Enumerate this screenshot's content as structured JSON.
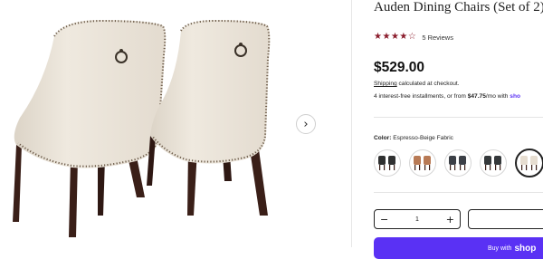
{
  "product": {
    "title": "Auden Dining Chairs (Set of 2)",
    "rating": {
      "stars": 4,
      "max": 5,
      "filled_color": "#8b1c2c",
      "empty_color": "#8b1c2c"
    },
    "reviews_text": "5 Reviews",
    "price": "$529.00",
    "shipping_link": "Shipping",
    "shipping_rest": " calculated at checkout.",
    "installments_prefix": "4 interest-free installments, or from ",
    "installments_amount": "$47.75",
    "installments_suffix": "/mo with ",
    "installments_link": "sho"
  },
  "gallery": {
    "next_icon": "chevron-right-icon",
    "next_glyph": "›"
  },
  "options": {
    "color_label": "Color:",
    "color_value": "Espresso-Beige Fabric",
    "swatches": [
      {
        "color": "#2f3030",
        "selected": false
      },
      {
        "color": "#b87a55",
        "selected": false
      },
      {
        "color": "#3b3f46",
        "selected": false
      },
      {
        "color": "#34383a",
        "selected": false
      },
      {
        "color": "#e6ddd0",
        "selected": true
      }
    ]
  },
  "cart": {
    "minus": "−",
    "quantity": "1",
    "plus": "+",
    "shop_pay_prefix": "Buy with",
    "shop_pay_brand": "shop"
  },
  "colors": {
    "brand_purple": "#5a31f4",
    "chair_fabric": "#ece5da",
    "chair_legs": "#3a1f18",
    "nailhead": "#6b5a48"
  }
}
